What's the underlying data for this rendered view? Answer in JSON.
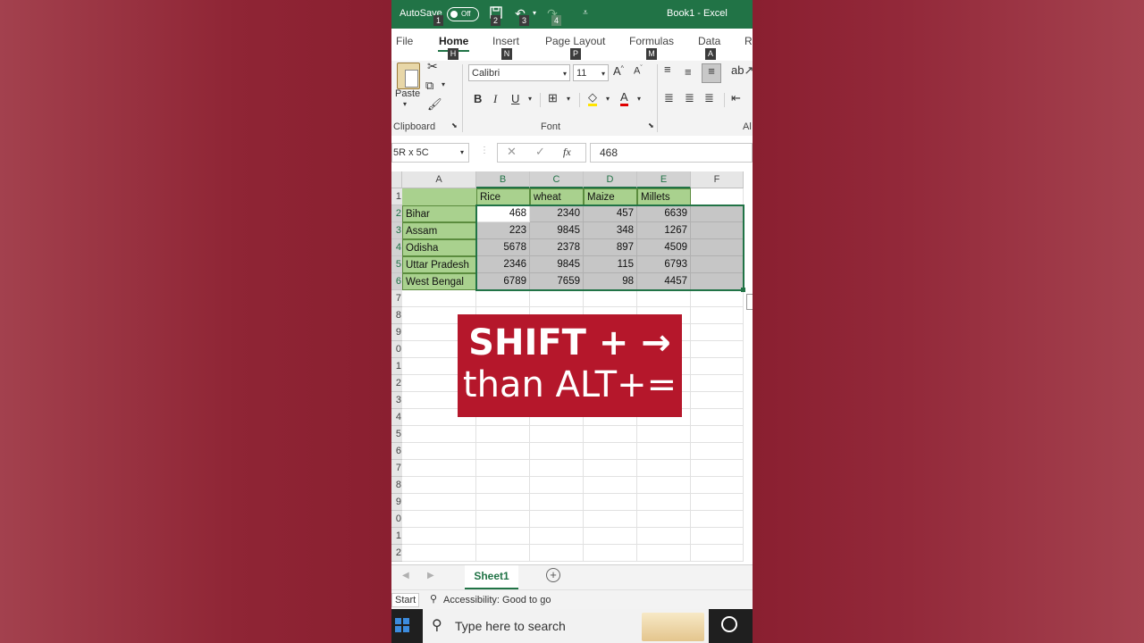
{
  "title_bar": {
    "autosave_label": "AutoSave",
    "toggle_state": "Off",
    "keytips": [
      "1",
      "2",
      "3",
      "4"
    ],
    "document_title": "Book1  -  Excel"
  },
  "ribbon_tabs": [
    {
      "label": "File",
      "keytip": ""
    },
    {
      "label": "Home",
      "keytip": "H"
    },
    {
      "label": "Insert",
      "keytip": "N"
    },
    {
      "label": "Page Layout",
      "keytip": "P"
    },
    {
      "label": "Formulas",
      "keytip": "M"
    },
    {
      "label": "Data",
      "keytip": "A"
    },
    {
      "label": "Re",
      "keytip": ""
    }
  ],
  "ribbon": {
    "paste_label": "Paste",
    "clipboard_group": "Clipboard",
    "font_name": "Calibri",
    "font_size": "11",
    "font_group": "Font",
    "alignment_group_partial": "Al",
    "bold": "B",
    "italic": "I",
    "underline": "U",
    "font_color_letter": "A"
  },
  "formula_bar": {
    "name_box": "5R x 5C",
    "fx_label": "fx",
    "value": "468"
  },
  "sheet": {
    "columns": [
      "A",
      "B",
      "C",
      "D",
      "E",
      "F"
    ],
    "row_numbers": [
      "1",
      "2",
      "3",
      "4",
      "5",
      "6",
      "7",
      "8",
      "9",
      "0",
      "1",
      "2",
      "3",
      "4",
      "5",
      "6",
      "7",
      "8",
      "9",
      "0",
      "1",
      "2"
    ],
    "headers": [
      "Rice",
      "wheat",
      "Maize",
      "Millets"
    ],
    "rows": [
      {
        "label": "Bihar",
        "values": [
          "468",
          "2340",
          "457",
          "6639"
        ]
      },
      {
        "label": "Assam",
        "values": [
          "223",
          "9845",
          "348",
          "1267"
        ]
      },
      {
        "label": "Odisha",
        "values": [
          "5678",
          "2378",
          "897",
          "4509"
        ]
      },
      {
        "label": "Uttar Pradesh",
        "values": [
          "2346",
          "9845",
          "115",
          "6793"
        ]
      },
      {
        "label": "West Bengal",
        "values": [
          "6789",
          "7659",
          "98",
          "4457"
        ]
      }
    ]
  },
  "overlay": {
    "line1": "SHIFT + →",
    "line2": "than ALT+="
  },
  "sheet_tabs": {
    "active_sheet": "Sheet1",
    "add_symbol": "+"
  },
  "status_bar": {
    "mode": "Start",
    "accessibility": "Accessibility: Good to go"
  },
  "taskbar": {
    "search_placeholder": "Type here to search"
  },
  "colors": {
    "excel_green": "#217346",
    "header_fill": "#a9d18e",
    "selection_fill": "#c6c6c6",
    "overlay_red": "#b5172b"
  }
}
